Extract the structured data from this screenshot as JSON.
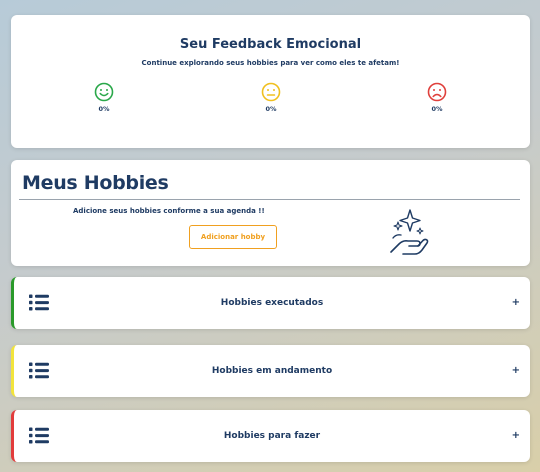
{
  "feedback": {
    "title": "Seu Feedback Emocional",
    "subtitle": "Continue explorando seus hobbies para ver como eles te afetam!",
    "emotions": [
      {
        "icon": "happy-face-icon",
        "color": "#2aa84a",
        "percent": "0%"
      },
      {
        "icon": "neutral-face-icon",
        "color": "#f0c020",
        "percent": "0%"
      },
      {
        "icon": "sad-face-icon",
        "color": "#e0403c",
        "percent": "0%"
      }
    ]
  },
  "hobbies": {
    "title": "Meus Hobbies",
    "description": "Adicione seus hobbies conforme a sua agenda !!",
    "add_button": "Adicionar hobby",
    "illustration": "hand-sparkles-icon"
  },
  "sections": [
    {
      "label": "Hobbies executados",
      "accent": "#2a9a2a",
      "icon": "list-icon",
      "toggle": "+"
    },
    {
      "label": "Hobbies em andamento",
      "accent": "#f2e43c",
      "icon": "list-icon",
      "toggle": "+"
    },
    {
      "label": "Hobbies para fazer",
      "accent": "#e23b3b",
      "icon": "list-icon",
      "toggle": "+"
    }
  ]
}
